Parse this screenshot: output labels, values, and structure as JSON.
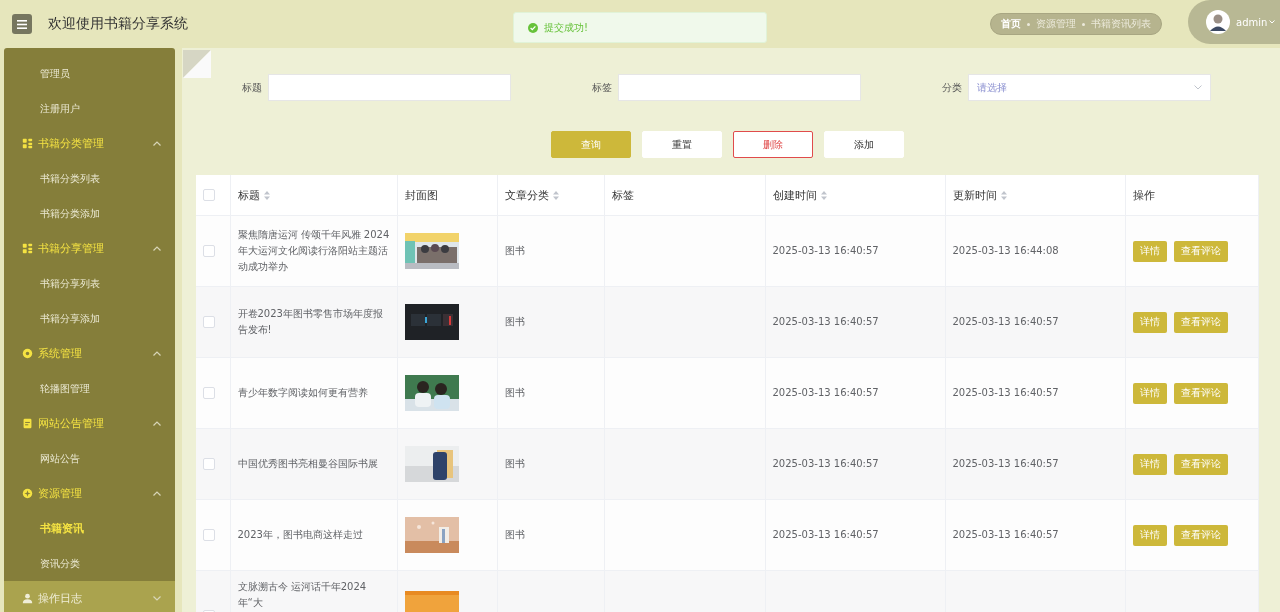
{
  "header": {
    "title": "欢迎使用书籍分享系统",
    "breadcrumb": [
      "首页",
      "资源管理",
      "书籍资讯列表"
    ],
    "user": "admin"
  },
  "toast": {
    "message": "提交成功!"
  },
  "sidebar": {
    "items": [
      {
        "kind": "sub",
        "label": "管理员",
        "selected": false
      },
      {
        "kind": "sub",
        "label": "注册用户",
        "selected": false
      },
      {
        "kind": "group",
        "label": "书籍分类管理",
        "expanded": true,
        "hovered": false,
        "children": [
          {
            "label": "书籍分类列表",
            "selected": false
          },
          {
            "label": "书籍分类添加",
            "selected": false
          }
        ]
      },
      {
        "kind": "group",
        "label": "书籍分享管理",
        "expanded": true,
        "hovered": false,
        "children": [
          {
            "label": "书籍分享列表",
            "selected": false
          },
          {
            "label": "书籍分享添加",
            "selected": false
          }
        ]
      },
      {
        "kind": "group",
        "label": "系统管理",
        "expanded": true,
        "hovered": false,
        "children": [
          {
            "label": "轮播图管理",
            "selected": false
          }
        ]
      },
      {
        "kind": "group",
        "label": "网站公告管理",
        "expanded": true,
        "hovered": false,
        "children": [
          {
            "label": "网站公告",
            "selected": false
          }
        ]
      },
      {
        "kind": "group",
        "label": "资源管理",
        "expanded": true,
        "hovered": false,
        "children": [
          {
            "label": "书籍资讯",
            "selected": true
          },
          {
            "label": "资讯分类",
            "selected": false
          }
        ]
      },
      {
        "kind": "group",
        "label": "操作日志",
        "expanded": false,
        "hovered": true
      }
    ]
  },
  "filters": [
    {
      "kind": "input",
      "label": "标题"
    },
    {
      "kind": "input",
      "label": "标签"
    },
    {
      "kind": "select",
      "label": "分类",
      "placeholder": "请选择"
    }
  ],
  "buttons": [
    {
      "kind": "primary",
      "label": "查询"
    },
    {
      "kind": "plain",
      "label": "重置"
    },
    {
      "kind": "danger",
      "label": "删除"
    },
    {
      "kind": "plain",
      "label": "添加"
    }
  ],
  "table": {
    "all_checked": false,
    "columns": [
      {
        "label": "标题",
        "sortable": true
      },
      {
        "label": "封面图",
        "sortable": false
      },
      {
        "label": "文章分类",
        "sortable": true
      },
      {
        "label": "标签",
        "sortable": false
      },
      {
        "label": "创建时间",
        "sortable": true
      },
      {
        "label": "更新时间",
        "sortable": true
      },
      {
        "label": "操作",
        "sortable": false
      }
    ],
    "rows": [
      {
        "checked": false,
        "title": "聚焦隋唐运河 传颂千年风雅 2024年大运河文化阅读行洛阳站主题活动成功举办",
        "cover": {
          "kind": "picture"
        },
        "category": "图书",
        "created": "2025-03-13 16:40:57",
        "updated": "2025-03-13 16:44:08",
        "actions": [
          "详情",
          "查看评论"
        ]
      },
      {
        "checked": false,
        "title": "开卷2023年图书零售市场年度报告发布!",
        "cover": {
          "kind": "picture"
        },
        "category": "图书",
        "created": "2025-03-13 16:40:57",
        "updated": "2025-03-13 16:40:57",
        "actions": [
          "详情",
          "查看评论"
        ]
      },
      {
        "checked": false,
        "title": "青少年数字阅读如何更有营养",
        "cover": {
          "kind": "picture"
        },
        "category": "图书",
        "created": "2025-03-13 16:40:57",
        "updated": "2025-03-13 16:40:57",
        "actions": [
          "详情",
          "查看评论"
        ]
      },
      {
        "checked": false,
        "title": "中国优秀图书亮相曼谷国际书展",
        "cover": {
          "kind": "picture"
        },
        "category": "图书",
        "created": "2025-03-13 16:40:57",
        "updated": "2025-03-13 16:40:57",
        "actions": [
          "详情",
          "查看评论"
        ]
      },
      {
        "checked": false,
        "title": "2023年，图书电商这样走过",
        "cover": {
          "kind": "picture"
        },
        "category": "图书",
        "created": "2025-03-13 16:40:57",
        "updated": "2025-03-13 16:40:57",
        "actions": [
          "详情",
          "查看评论"
        ]
      },
      {
        "checked": false,
        "title": "文脉溯古今 运河话千年2024年“大",
        "cover": {
          "kind": "picture"
        }
      }
    ]
  }
}
